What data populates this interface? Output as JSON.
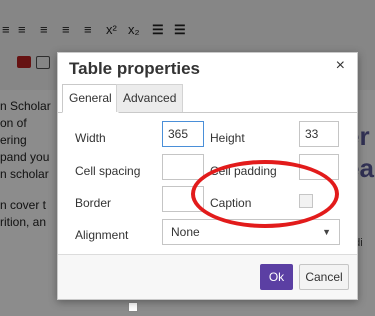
{
  "background": {
    "toolbar_glyphs": [
      "≡",
      "≡",
      "≡",
      "≡",
      "≡",
      "x²",
      "x₂",
      "☰",
      "☰"
    ],
    "left_text": [
      "n Scholar",
      "on of",
      "ering",
      "pand you",
      "n scholar",
      "",
      "n cover t",
      "rition, an"
    ],
    "right_text_large": [
      "er",
      "ea"
    ],
    "right_text_small": [
      "udi",
      "y"
    ]
  },
  "dialog": {
    "title": "Table properties",
    "close_glyph": "×",
    "tabs": [
      {
        "label": "General",
        "active": true
      },
      {
        "label": "Advanced",
        "active": false
      }
    ],
    "fields": {
      "width_label": "Width",
      "width_value": "365",
      "height_label": "Height",
      "height_value": "33",
      "cell_spacing_label": "Cell spacing",
      "cell_spacing_value": "",
      "cell_padding_label": "Cell padding",
      "cell_padding_value": "",
      "border_label": "Border",
      "border_value": "",
      "caption_label": "Caption",
      "caption_checked": false,
      "alignment_label": "Alignment",
      "alignment_value": "None"
    },
    "buttons": {
      "ok": "Ok",
      "cancel": "Cancel"
    }
  },
  "colors": {
    "ok_button": "#5b3fa3",
    "highlight_circle": "#e21b1b"
  }
}
